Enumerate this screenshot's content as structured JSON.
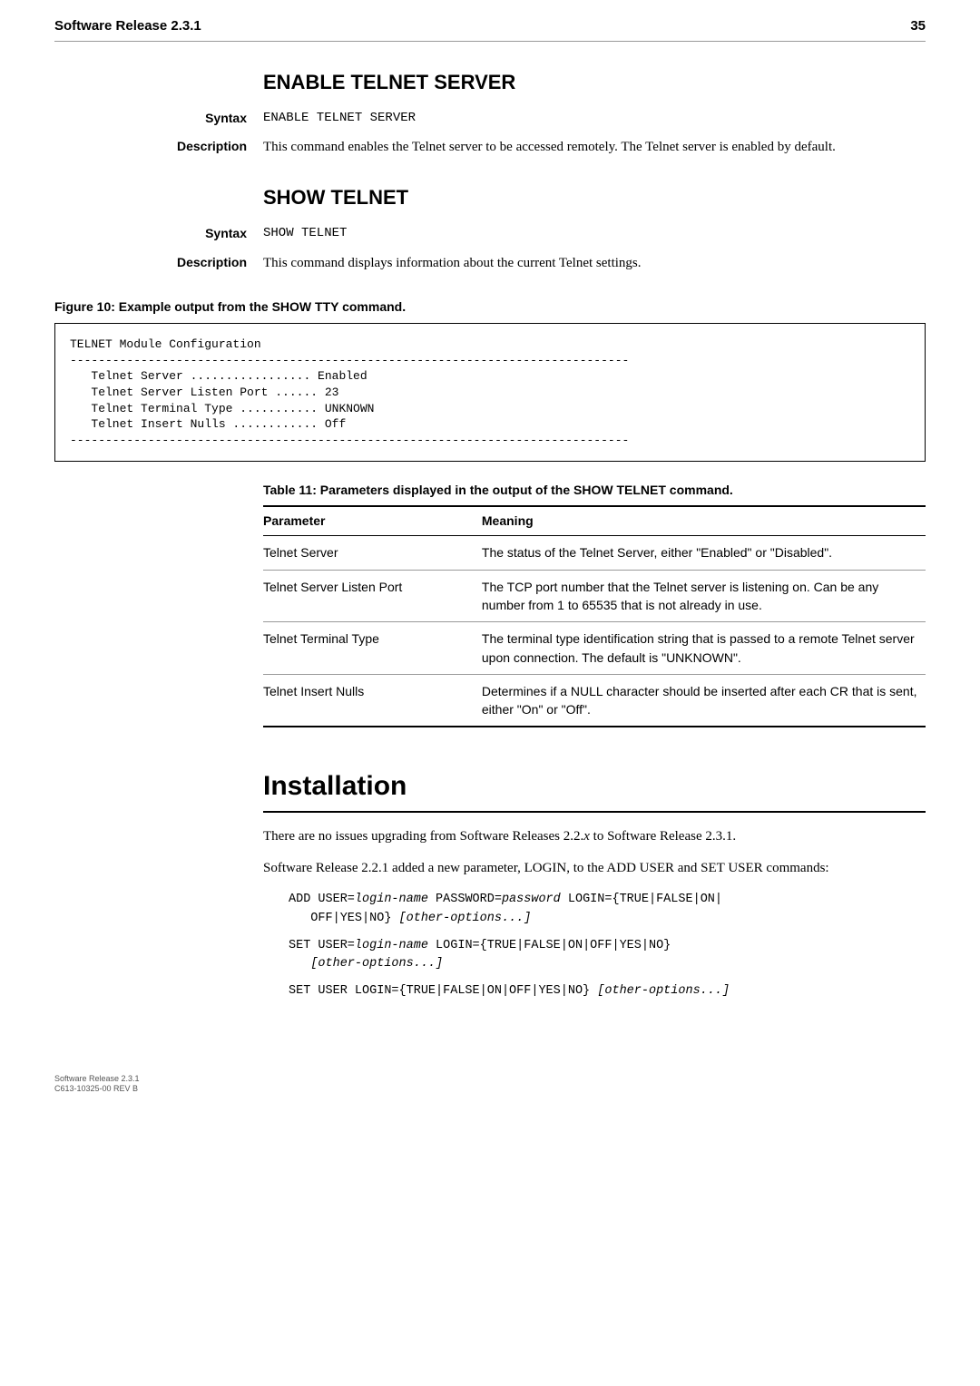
{
  "header": {
    "title": "Software Release 2.3.1",
    "page": "35"
  },
  "section1": {
    "heading": "ENABLE TELNET SERVER",
    "syntax_label": "Syntax",
    "syntax_value": "ENABLE TELNET SERVER",
    "desc_label": "Description",
    "desc_value": "This command enables the Telnet server to be accessed remotely. The Telnet server is enabled by default."
  },
  "section2": {
    "heading": "SHOW TELNET",
    "syntax_label": "Syntax",
    "syntax_value": "SHOW TELNET",
    "desc_label": "Description",
    "desc_value": "This command displays information about the current Telnet settings."
  },
  "figure": {
    "caption": "Figure 10: Example output from the SHOW TTY command.",
    "code": "TELNET Module Configuration\n-------------------------------------------------------------------------------\n   Telnet Server ................. Enabled\n   Telnet Server Listen Port ...... 23\n   Telnet Terminal Type ........... UNKNOWN\n   Telnet Insert Nulls ............ Off\n-------------------------------------------------------------------------------"
  },
  "table": {
    "caption": "Table 11: Parameters displayed in the output of the SHOW TELNET command.",
    "col1": "Parameter",
    "col2": "Meaning",
    "rows": [
      {
        "p": "Telnet Server",
        "m": "The status of the Telnet Server, either \"Enabled\" or \"Disabled\"."
      },
      {
        "p": "Telnet Server Listen Port",
        "m": "The TCP port number that the Telnet server is listening on. Can be any number from 1 to 65535 that is not already in use."
      },
      {
        "p": "Telnet Terminal Type",
        "m": "The terminal type identification string that is passed to a remote Telnet server upon connection. The default is \"UNKNOWN\"."
      },
      {
        "p": "Telnet Insert Nulls",
        "m": "Determines if a NULL character should be inserted after each CR that is sent, either \"On\" or \"Off\"."
      }
    ]
  },
  "install": {
    "heading": "Installation",
    "para1_a": "There are no issues upgrading from Software Releases 2.2.",
    "para1_x": "x",
    "para1_b": " to Software Release 2.3.1.",
    "para2": "Software Release 2.2.1 added a new parameter, LOGIN, to the ADD USER and SET USER commands:",
    "cmd1_a": "ADD USER=",
    "cmd1_b": "login-name",
    "cmd1_c": " PASSWORD=",
    "cmd1_d": "password",
    "cmd1_e": " LOGIN={TRUE|FALSE|ON|\n   OFF|YES|NO} ",
    "cmd1_f": "[other-options...]",
    "cmd2_a": "SET USER=",
    "cmd2_b": "login-name",
    "cmd2_c": " LOGIN={TRUE|FALSE|ON|OFF|YES|NO} \n   ",
    "cmd2_d": "[other-options...]",
    "cmd3_a": "SET USER LOGIN={TRUE|FALSE|ON|OFF|YES|NO} ",
    "cmd3_b": "[other-options...]"
  },
  "footer": {
    "line1": "Software Release 2.3.1",
    "line2": "C613-10325-00 REV B"
  }
}
